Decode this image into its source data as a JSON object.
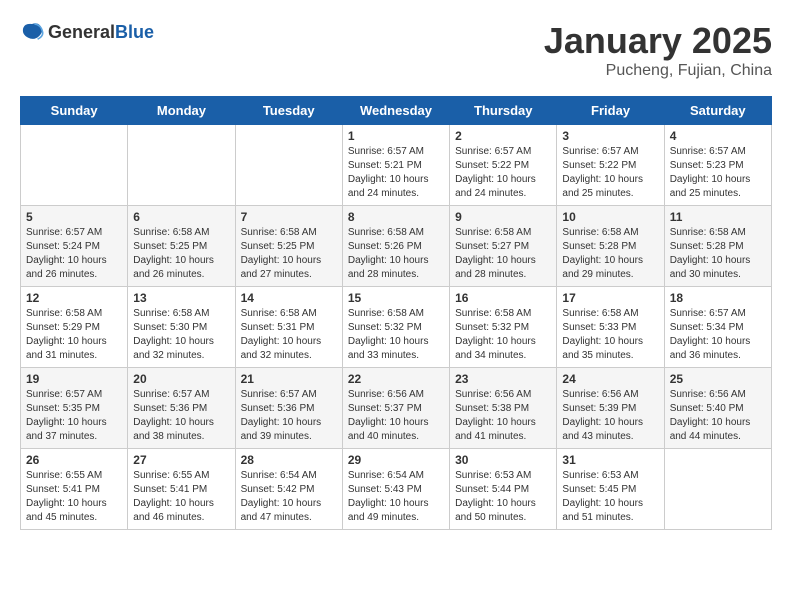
{
  "header": {
    "logo_general": "General",
    "logo_blue": "Blue",
    "title": "January 2025",
    "subtitle": "Pucheng, Fujian, China"
  },
  "days_of_week": [
    "Sunday",
    "Monday",
    "Tuesday",
    "Wednesday",
    "Thursday",
    "Friday",
    "Saturday"
  ],
  "weeks": [
    [
      {
        "day": "",
        "info": ""
      },
      {
        "day": "",
        "info": ""
      },
      {
        "day": "",
        "info": ""
      },
      {
        "day": "1",
        "info": "Sunrise: 6:57 AM\nSunset: 5:21 PM\nDaylight: 10 hours and 24 minutes."
      },
      {
        "day": "2",
        "info": "Sunrise: 6:57 AM\nSunset: 5:22 PM\nDaylight: 10 hours and 24 minutes."
      },
      {
        "day": "3",
        "info": "Sunrise: 6:57 AM\nSunset: 5:22 PM\nDaylight: 10 hours and 25 minutes."
      },
      {
        "day": "4",
        "info": "Sunrise: 6:57 AM\nSunset: 5:23 PM\nDaylight: 10 hours and 25 minutes."
      }
    ],
    [
      {
        "day": "5",
        "info": "Sunrise: 6:57 AM\nSunset: 5:24 PM\nDaylight: 10 hours and 26 minutes."
      },
      {
        "day": "6",
        "info": "Sunrise: 6:58 AM\nSunset: 5:25 PM\nDaylight: 10 hours and 26 minutes."
      },
      {
        "day": "7",
        "info": "Sunrise: 6:58 AM\nSunset: 5:25 PM\nDaylight: 10 hours and 27 minutes."
      },
      {
        "day": "8",
        "info": "Sunrise: 6:58 AM\nSunset: 5:26 PM\nDaylight: 10 hours and 28 minutes."
      },
      {
        "day": "9",
        "info": "Sunrise: 6:58 AM\nSunset: 5:27 PM\nDaylight: 10 hours and 28 minutes."
      },
      {
        "day": "10",
        "info": "Sunrise: 6:58 AM\nSunset: 5:28 PM\nDaylight: 10 hours and 29 minutes."
      },
      {
        "day": "11",
        "info": "Sunrise: 6:58 AM\nSunset: 5:28 PM\nDaylight: 10 hours and 30 minutes."
      }
    ],
    [
      {
        "day": "12",
        "info": "Sunrise: 6:58 AM\nSunset: 5:29 PM\nDaylight: 10 hours and 31 minutes."
      },
      {
        "day": "13",
        "info": "Sunrise: 6:58 AM\nSunset: 5:30 PM\nDaylight: 10 hours and 32 minutes."
      },
      {
        "day": "14",
        "info": "Sunrise: 6:58 AM\nSunset: 5:31 PM\nDaylight: 10 hours and 32 minutes."
      },
      {
        "day": "15",
        "info": "Sunrise: 6:58 AM\nSunset: 5:32 PM\nDaylight: 10 hours and 33 minutes."
      },
      {
        "day": "16",
        "info": "Sunrise: 6:58 AM\nSunset: 5:32 PM\nDaylight: 10 hours and 34 minutes."
      },
      {
        "day": "17",
        "info": "Sunrise: 6:58 AM\nSunset: 5:33 PM\nDaylight: 10 hours and 35 minutes."
      },
      {
        "day": "18",
        "info": "Sunrise: 6:57 AM\nSunset: 5:34 PM\nDaylight: 10 hours and 36 minutes."
      }
    ],
    [
      {
        "day": "19",
        "info": "Sunrise: 6:57 AM\nSunset: 5:35 PM\nDaylight: 10 hours and 37 minutes."
      },
      {
        "day": "20",
        "info": "Sunrise: 6:57 AM\nSunset: 5:36 PM\nDaylight: 10 hours and 38 minutes."
      },
      {
        "day": "21",
        "info": "Sunrise: 6:57 AM\nSunset: 5:36 PM\nDaylight: 10 hours and 39 minutes."
      },
      {
        "day": "22",
        "info": "Sunrise: 6:56 AM\nSunset: 5:37 PM\nDaylight: 10 hours and 40 minutes."
      },
      {
        "day": "23",
        "info": "Sunrise: 6:56 AM\nSunset: 5:38 PM\nDaylight: 10 hours and 41 minutes."
      },
      {
        "day": "24",
        "info": "Sunrise: 6:56 AM\nSunset: 5:39 PM\nDaylight: 10 hours and 43 minutes."
      },
      {
        "day": "25",
        "info": "Sunrise: 6:56 AM\nSunset: 5:40 PM\nDaylight: 10 hours and 44 minutes."
      }
    ],
    [
      {
        "day": "26",
        "info": "Sunrise: 6:55 AM\nSunset: 5:41 PM\nDaylight: 10 hours and 45 minutes."
      },
      {
        "day": "27",
        "info": "Sunrise: 6:55 AM\nSunset: 5:41 PM\nDaylight: 10 hours and 46 minutes."
      },
      {
        "day": "28",
        "info": "Sunrise: 6:54 AM\nSunset: 5:42 PM\nDaylight: 10 hours and 47 minutes."
      },
      {
        "day": "29",
        "info": "Sunrise: 6:54 AM\nSunset: 5:43 PM\nDaylight: 10 hours and 49 minutes."
      },
      {
        "day": "30",
        "info": "Sunrise: 6:53 AM\nSunset: 5:44 PM\nDaylight: 10 hours and 50 minutes."
      },
      {
        "day": "31",
        "info": "Sunrise: 6:53 AM\nSunset: 5:45 PM\nDaylight: 10 hours and 51 minutes."
      },
      {
        "day": "",
        "info": ""
      }
    ]
  ]
}
